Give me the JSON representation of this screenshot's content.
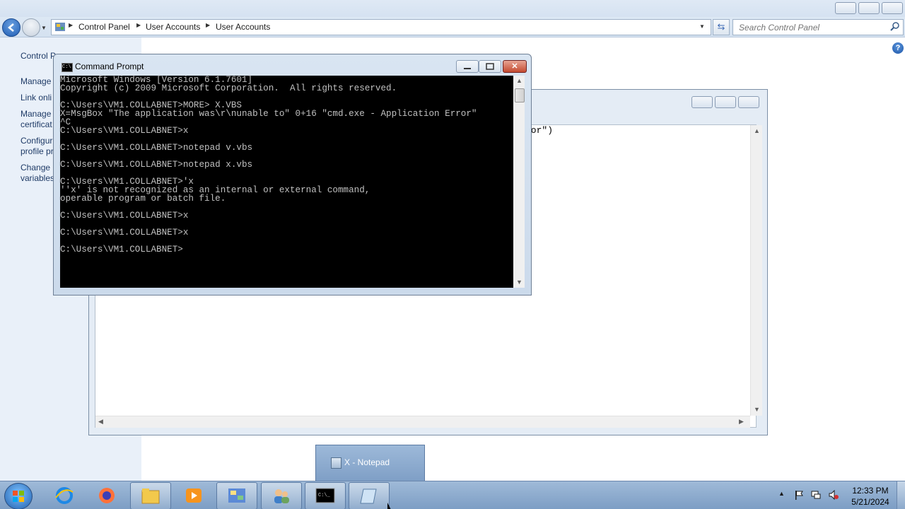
{
  "control_panel": {
    "breadcrumbs": [
      "Control Panel",
      "User Accounts",
      "User Accounts"
    ],
    "search_placeholder": "Search Control Panel",
    "left_links": [
      "Control P...",
      "Manage",
      "Link onli",
      "Manage",
      "certificat",
      "Configur",
      "profile pr",
      "Change",
      "variables"
    ]
  },
  "notepad": {
    "visible_text": "ror\")"
  },
  "cmd": {
    "title": "Command Prompt",
    "lines": [
      "Microsoft Windows [Version 6.1.7601]",
      "Copyright (c) 2009 Microsoft Corporation.  All rights reserved.",
      "",
      "C:\\Users\\VM1.COLLABNET>MORE> X.VBS",
      "X=MsgBox \"The application was\\r\\nunable to\" 0+16 \"cmd.exe - Application Error\"",
      "^C",
      "C:\\Users\\VM1.COLLABNET>x",
      "",
      "C:\\Users\\VM1.COLLABNET>notepad v.vbs",
      "",
      "C:\\Users\\VM1.COLLABNET>notepad x.vbs",
      "",
      "C:\\Users\\VM1.COLLABNET>'x",
      "''x' is not recognized as an internal or external command,",
      "operable program or batch file.",
      "",
      "C:\\Users\\VM1.COLLABNET>x",
      "",
      "C:\\Users\\VM1.COLLABNET>x",
      "",
      "C:\\Users\\VM1.COLLABNET>"
    ]
  },
  "taskbar": {
    "thumbnail_label": "X - Notepad",
    "time": "12:33 PM",
    "date": "5/21/2024",
    "items": [
      "internet-explorer-icon",
      "firefox-icon",
      "file-explorer-icon",
      "media-player-icon",
      "control-panel-icon",
      "user-accounts-icon",
      "command-prompt-icon",
      "notepad-icon"
    ]
  }
}
